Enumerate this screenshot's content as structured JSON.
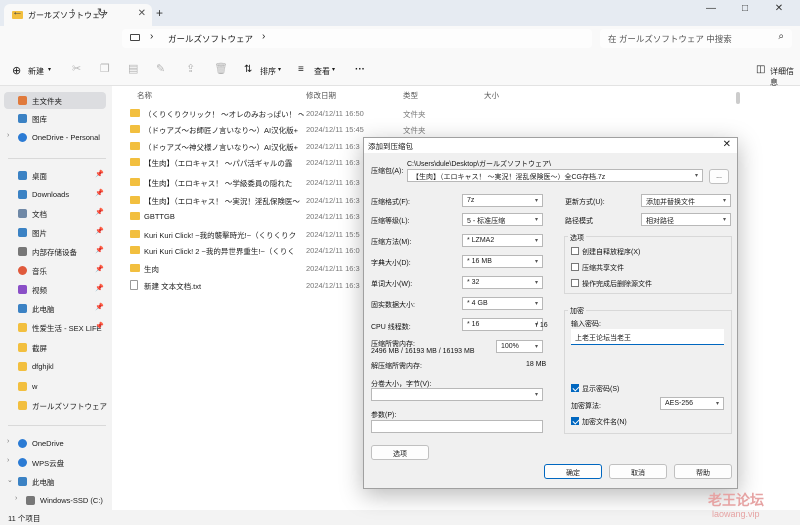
{
  "window": {
    "tab_title": "ガールズソフトウェア",
    "new_tab": "+",
    "controls": [
      "—",
      "□",
      "✕"
    ]
  },
  "nav": {
    "address_path": "ガールズソフトウェア",
    "search_placeholder": "在 ガールズソフトウェア 中搜索"
  },
  "toolbar": {
    "new_label": "新建",
    "sort_label": "排序",
    "view_label": "查看",
    "more_label": "···",
    "details_label": "详细信息"
  },
  "sidebar": {
    "items": [
      {
        "label": "主文件夹",
        "color": "#e07a3c"
      },
      {
        "label": "图库",
        "color": "#3b82c4"
      },
      {
        "label": "OneDrive - Personal",
        "color": "#2b7bd4"
      },
      {
        "label": "桌面",
        "color": "#3b82c4"
      },
      {
        "label": "Downloads",
        "color": "#3b82c4"
      },
      {
        "label": "文档",
        "color": "#6f88a6"
      },
      {
        "label": "图片",
        "color": "#3b82c4"
      },
      {
        "label": "内部存储设备",
        "color": "#777"
      },
      {
        "label": "音乐",
        "color": "#e05a3c"
      },
      {
        "label": "视频",
        "color": "#8a4fc7"
      },
      {
        "label": "此电脑",
        "color": "#3b82c4"
      },
      {
        "label": "性爱生活 - SEX LIFE",
        "color": "#f2bf3f"
      },
      {
        "label": "截屏",
        "color": "#f2bf3f"
      },
      {
        "label": "dfghjkl",
        "color": "#f2bf3f"
      },
      {
        "label": "w",
        "color": "#f2bf3f"
      },
      {
        "label": "ガールズソフトウェア",
        "color": "#f2bf3f"
      },
      {
        "label": "OneDrive",
        "color": "#2b7bd4"
      },
      {
        "label": "WPS云盘",
        "color": "#2b7bd4"
      },
      {
        "label": "此电脑",
        "color": "#3b82c4"
      },
      {
        "label": "Windows-SSD (C:)",
        "color": "#777"
      }
    ]
  },
  "file_list": {
    "headers": {
      "name": "名称",
      "date": "修改日期",
      "type": "类型",
      "size": "大小"
    },
    "rows": [
      {
        "name": "（くりくりクリック！ ～オレのみおっぱい！ ～",
        "date": "2024/12/11 16:50",
        "type": "文件夹",
        "file": false
      },
      {
        "name": "（ドゥアズ～お師匠ノ言いなり～）AI汉化版+",
        "date": "2024/12/11 15:45",
        "type": "文件夹",
        "file": false
      },
      {
        "name": "（ドゥアズ～神父様ノ言いなり～）AI汉化版+",
        "date": "2024/12/11 16:3",
        "type": "",
        "file": false
      },
      {
        "name": "【生肉】（エロキャス！ ～パパ活ギャルの露",
        "date": "2024/12/11 16:3",
        "type": "",
        "file": false
      },
      {
        "name": "【生肉】（エロキャス！ ～学級委員の隠れた",
        "date": "2024/12/11 16:3",
        "type": "",
        "file": false
      },
      {
        "name": "【生肉】（エロキャス！ ～実況！淫乱保険医～",
        "date": "2024/12/11 16:3",
        "type": "",
        "file": false
      },
      {
        "name": "GBTTGB",
        "date": "2024/12/11 16:3",
        "type": "",
        "file": false
      },
      {
        "name": "Kuri Kuri Click! ~我的襲擊時光!~（くりくりク",
        "date": "2024/12/11 15:5",
        "type": "",
        "file": false
      },
      {
        "name": "Kuri Kuri Click! 2 ~我的异世界重生!~（くりく",
        "date": "2024/12/11 16:0",
        "type": "",
        "file": false
      },
      {
        "name": "生肉",
        "date": "2024/12/11 16:3",
        "type": "",
        "file": false
      },
      {
        "name": "新建 文本文档.txt",
        "date": "2024/12/11 16:3",
        "type": "",
        "file": true
      }
    ]
  },
  "status": {
    "count": "11 个项目"
  },
  "dialog": {
    "title": "添加到压缩包",
    "close": "✕",
    "archive_name_label": "压缩包(A):",
    "archive_path": "C:\\Users\\dule\\Desktop\\ガールズソフトウェア\\",
    "archive_name": "【生肉】（エロキャス！ ～実況！淫乱保険医～）全CG存档.7z",
    "browse": "...",
    "format_label": "压缩格式(F):",
    "format_value": "7z",
    "level_label": "压缩等级(L):",
    "level_value": "5 - 标准压缩",
    "method_label": "压缩方法(M):",
    "method_value": "* LZMA2",
    "dict_label": "字典大小(D):",
    "dict_value": "* 16 MB",
    "word_label": "单词大小(W):",
    "word_value": "* 32",
    "solid_label": "固实数据大小:",
    "solid_value": "* 4 GB",
    "threads_label": "CPU 线程数:",
    "threads_value": "* 16",
    "threads_total": "/ 16",
    "mem_label": "压缩所需内存:",
    "mem_value": "2496 MB / 16193 MB / 16193 MB",
    "mem_pct": "100%",
    "decomp_label": "解压缩所需内存:",
    "decomp_value": "18 MB",
    "split_label": "分卷大小，字节(V):",
    "params_label": "参数(P):",
    "options_btn": "选项",
    "update_label": "更新方式(U):",
    "update_value": "添加并替换文件",
    "path_label": "路径模式",
    "path_value": "相对路径",
    "options_group": "选项",
    "opt_sfx": "创建自释放程序(X)",
    "opt_shared": "压缩共享文件",
    "opt_delete": "操作完成后删除源文件",
    "encrypt_group": "加密",
    "pw_label": "输入密码:",
    "pw_value": "上老王论坛当老王",
    "show_pw": "显示密码(S)",
    "enc_method_label": "加密算法:",
    "enc_method_value": "AES-256",
    "enc_names": "加密文件名(N)",
    "ok": "确定",
    "cancel": "取消",
    "help": "帮助"
  },
  "watermark": {
    "line1": "老王论坛",
    "line2": "laowang.vip"
  }
}
